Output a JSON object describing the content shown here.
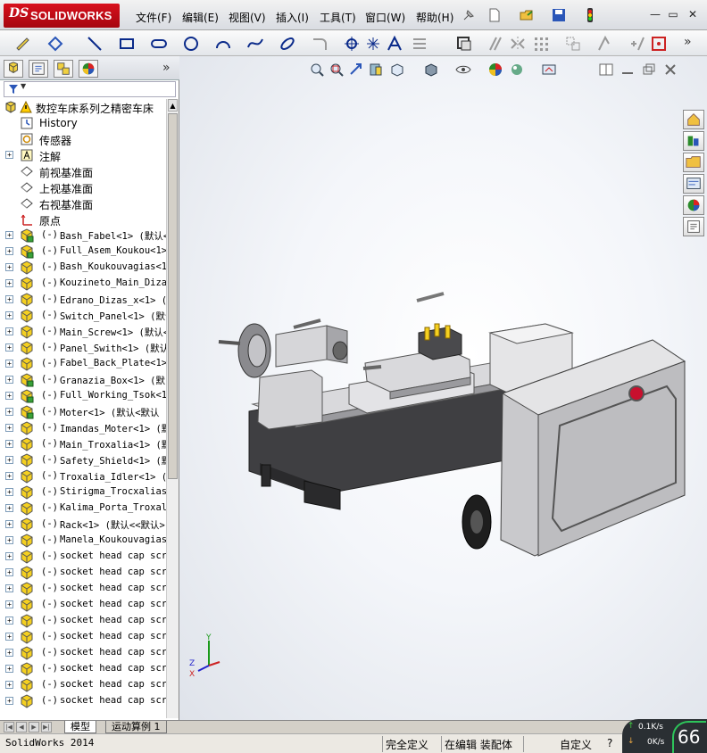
{
  "app": {
    "logo_prefix": "DS",
    "logo_text": "SOLIDWORKS"
  },
  "menu": [
    "文件(F)",
    "编辑(E)",
    "视图(V)",
    "插入(I)",
    "工具(T)",
    "窗口(W)",
    "帮助(H)"
  ],
  "window_controls": {
    "minimize": "—",
    "restore": "▭",
    "close": "✕"
  },
  "feature_manager": {
    "tabs": [
      "feature-tree",
      "property-manager",
      "configuration-manager",
      "display-manager"
    ],
    "collapse_glyph": "»",
    "filter_glyph": "▼",
    "root": "数控车床系列之精密车床",
    "items": [
      {
        "kind": "feat",
        "icon": "history-icon",
        "expand": "",
        "label": "History"
      },
      {
        "kind": "feat",
        "icon": "sensor-icon",
        "expand": "",
        "label": "传感器"
      },
      {
        "kind": "feat",
        "icon": "annotation-icon",
        "expand": "+",
        "label": "注解"
      },
      {
        "kind": "feat",
        "icon": "plane-icon",
        "expand": "",
        "label": "前视基准面"
      },
      {
        "kind": "feat",
        "icon": "plane-icon",
        "expand": "",
        "label": "上视基准面"
      },
      {
        "kind": "feat",
        "icon": "plane-icon",
        "expand": "",
        "label": "右视基准面"
      },
      {
        "kind": "feat",
        "icon": "origin-icon",
        "expand": "",
        "label": "原点"
      },
      {
        "kind": "asm",
        "icon": "subassembly-icon",
        "expand": "+",
        "prefix": "(-)",
        "label": "Bash_Fabel<1> (默认<"
      },
      {
        "kind": "asm",
        "icon": "subassembly-icon",
        "expand": "+",
        "prefix": "(-)",
        "label": "Full_Asem_Koukou<1>"
      },
      {
        "kind": "part",
        "icon": "part-icon",
        "expand": "+",
        "prefix": "(-)",
        "label": "Bash_Koukouvagias<1>"
      },
      {
        "kind": "part",
        "icon": "part-icon",
        "expand": "+",
        "prefix": "(-)",
        "label": "Kouzineto_Main_Dizas"
      },
      {
        "kind": "part",
        "icon": "part-icon",
        "expand": "+",
        "prefix": "(-)",
        "label": "Edrano_Dizas_x<1> (默"
      },
      {
        "kind": "part",
        "icon": "part-icon",
        "expand": "+",
        "prefix": "(-)",
        "label": "Switch_Panel<1> (默认"
      },
      {
        "kind": "part",
        "icon": "part-icon",
        "expand": "+",
        "prefix": "(-)",
        "label": "Main_Screw<1> (默认<"
      },
      {
        "kind": "part",
        "icon": "part-icon",
        "expand": "+",
        "prefix": "(-)",
        "label": "Panel_Swith<1> (默认<"
      },
      {
        "kind": "part",
        "icon": "part-icon",
        "expand": "+",
        "prefix": "(-)",
        "label": "Fabel_Back_Plate<1>"
      },
      {
        "kind": "asm",
        "icon": "subassembly-icon",
        "expand": "+",
        "prefix": "(-)",
        "label": "Granazia_Box<1> (默"
      },
      {
        "kind": "asm",
        "icon": "subassembly-icon",
        "expand": "+",
        "prefix": "(-)",
        "label": "Full_Working_Tsok<1>"
      },
      {
        "kind": "asm",
        "icon": "subassembly-icon",
        "expand": "+",
        "prefix": "(-)",
        "label": "Moter<1> (默认<默认"
      },
      {
        "kind": "part",
        "icon": "part-icon",
        "expand": "+",
        "prefix": "(-)",
        "label": "Imandas_Moter<1> (默"
      },
      {
        "kind": "part",
        "icon": "part-icon",
        "expand": "+",
        "prefix": "(-)",
        "label": "Main_Troxalia<1> (默"
      },
      {
        "kind": "part",
        "icon": "part-icon",
        "expand": "+",
        "prefix": "(-)",
        "label": "Safety_Shield<1> (默"
      },
      {
        "kind": "part",
        "icon": "part-icon",
        "expand": "+",
        "prefix": "(-)",
        "label": "Troxalia_Idler<1> (默"
      },
      {
        "kind": "part",
        "icon": "part-icon",
        "expand": "+",
        "prefix": "(-)",
        "label": "Stirigma_Trocxalias_"
      },
      {
        "kind": "part",
        "icon": "part-icon",
        "expand": "+",
        "prefix": "(-)",
        "label": "Kalima_Porta_Troxali"
      },
      {
        "kind": "part",
        "icon": "part-icon",
        "expand": "+",
        "prefix": "(-)",
        "label": "Rack<1> (默认<<默认>"
      },
      {
        "kind": "part",
        "icon": "part-icon",
        "expand": "+",
        "prefix": "(-)",
        "label": "Manela_Koukouvagias"
      },
      {
        "kind": "part",
        "icon": "part-icon",
        "expand": "+",
        "prefix": "(-)",
        "label": "socket head cap scre"
      },
      {
        "kind": "part",
        "icon": "part-icon",
        "expand": "+",
        "prefix": "(-)",
        "label": "socket head cap scre"
      },
      {
        "kind": "part",
        "icon": "part-icon",
        "expand": "+",
        "prefix": "(-)",
        "label": "socket head cap scre"
      },
      {
        "kind": "part",
        "icon": "part-icon",
        "expand": "+",
        "prefix": "(-)",
        "label": "socket head cap scre"
      },
      {
        "kind": "part",
        "icon": "part-icon",
        "expand": "+",
        "prefix": "(-)",
        "label": "socket head cap scre"
      },
      {
        "kind": "part",
        "icon": "part-icon",
        "expand": "+",
        "prefix": "(-)",
        "label": "socket head cap scre"
      },
      {
        "kind": "part",
        "icon": "part-icon",
        "expand": "+",
        "prefix": "(-)",
        "label": "socket head cap scre"
      },
      {
        "kind": "part",
        "icon": "part-icon",
        "expand": "+",
        "prefix": "(-)",
        "label": "socket head cap scre"
      },
      {
        "kind": "part",
        "icon": "part-icon",
        "expand": "+",
        "prefix": "(-)",
        "label": "socket head cap scre"
      },
      {
        "kind": "part",
        "icon": "part-icon",
        "expand": "+",
        "prefix": "(-)",
        "label": "socket head cap scre"
      }
    ]
  },
  "bottom_tabs": {
    "model": "模型",
    "motion": "运动算例 1"
  },
  "status": {
    "app_version": "SolidWorks 2014",
    "definition": "完全定义",
    "editing": "在编辑 装配体",
    "units": "自定义",
    "help": "?"
  },
  "net_monitor": {
    "up": "0.1K/s",
    "down": "0K/s",
    "cpu": "66"
  },
  "triad": {
    "x": "X",
    "y": "Y",
    "z": "Z"
  },
  "colors": {
    "accent_red": "#c8102e",
    "part_yellow": "#f5d020",
    "machine_gray": "#c9c9cc",
    "bed_dark": "#3f3f42"
  }
}
